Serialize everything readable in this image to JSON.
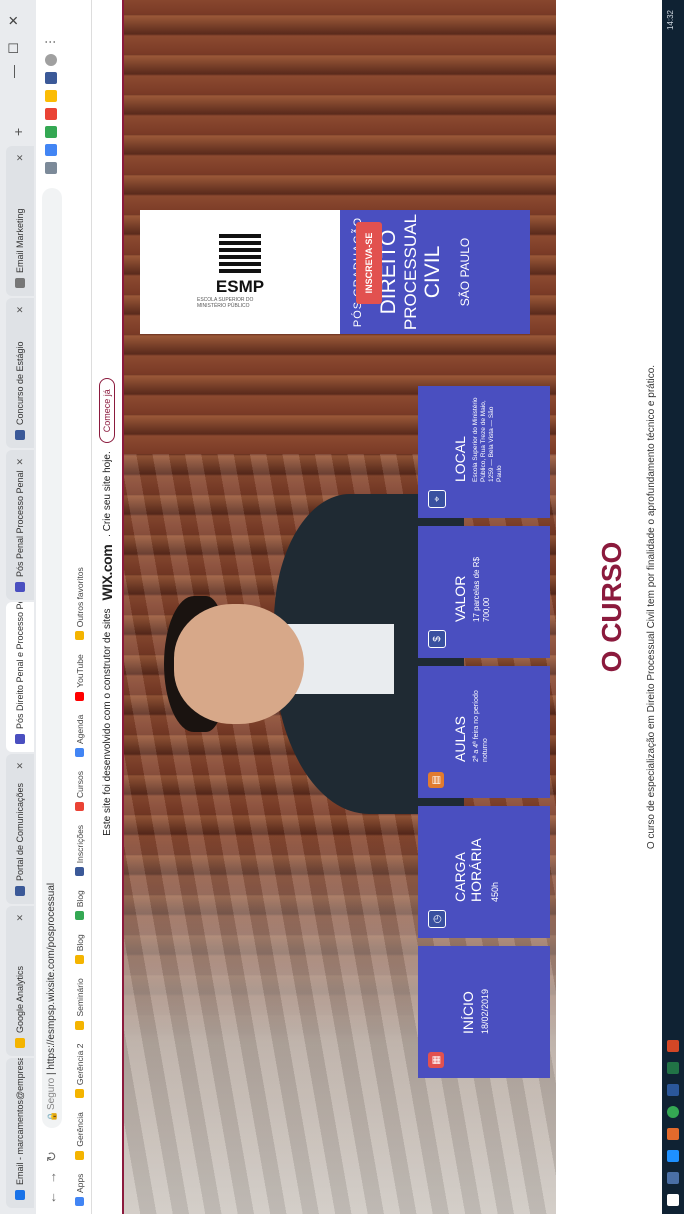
{
  "browser": {
    "tabs": [
      {
        "label": "Email - marcamentos@empresa",
        "color": "#1a73e8"
      },
      {
        "label": "Google Analytics",
        "color": "#f4b400"
      },
      {
        "label": "Portal de Comunicações",
        "color": "#3b5998"
      },
      {
        "label": "Pós Direito Penal e Processo Penal",
        "color": "#4a4fc0"
      },
      {
        "label": "Pós Penal Processo Penal",
        "color": "#4a4fc0"
      },
      {
        "label": "Concurso de Estágio",
        "color": "#3b5998"
      },
      {
        "label": "Email Marketing",
        "color": "#777777"
      }
    ],
    "new_tab": "+",
    "window_controls": [
      "—",
      "☐",
      "✕"
    ],
    "url_secure": "Seguro",
    "url": "https://esmpsp.wixsite.com/posprocessual",
    "bookmarks": [
      "Apps",
      "Gerência",
      "Gerência 2",
      "Seminário",
      "Blog",
      "Blog",
      "Inscrições",
      "Cursos",
      "Agenda",
      "YouTube",
      "Outros favoritos"
    ]
  },
  "wix_bar": {
    "text": "Este site foi desenvolvido com o construtor de sites",
    "brand": "WIX.com",
    "text2": ". Crie seu site hoje.",
    "button": "Comece já"
  },
  "hero": {
    "logo_name": "ESMP",
    "logo_sub": "ESCOLA SUPERIOR DO MINISTÉRIO PÚBLICO",
    "kicker": "PÓS GRADUAÇÃO",
    "title_lines": [
      "DIREITO",
      "PROCESSUAL",
      "CIVIL"
    ],
    "city": "SÃO PAULO",
    "cta": "INSCREVA-SE"
  },
  "cards": [
    {
      "title": "INÍCIO",
      "body": "18/02/2019",
      "icon": "calendar-icon",
      "accent": "#e2514f"
    },
    {
      "title": "CARGA HORÁRIA",
      "body": "450h",
      "icon": "clock-icon",
      "accent": "#3950a0"
    },
    {
      "title": "AULAS",
      "body": "2ª a 4ª feira no período noturno",
      "icon": "book-icon",
      "accent": "#e27b2f"
    },
    {
      "title": "VALOR",
      "body": "17 parcelas de R$ 700,00",
      "icon": "money-icon",
      "accent": "#3950a0"
    },
    {
      "title": "LOCAL",
      "body": "Escola Superior do Ministério Público, Rua Treze de Maio, 1259 — Bela Vista — São Paulo",
      "icon": "pin-icon",
      "accent": "#3950a0"
    }
  ],
  "section": {
    "title": "O CURSO",
    "text": "O curso de especialização em Direito Processual Civil tem por finalidade o aprofundamento técnico e prático."
  },
  "colors": {
    "primary": "#4a4fc0",
    "accent": "#8b1a3d",
    "cta": "#e2514f"
  },
  "taskbar": {
    "clock": "14:32"
  }
}
